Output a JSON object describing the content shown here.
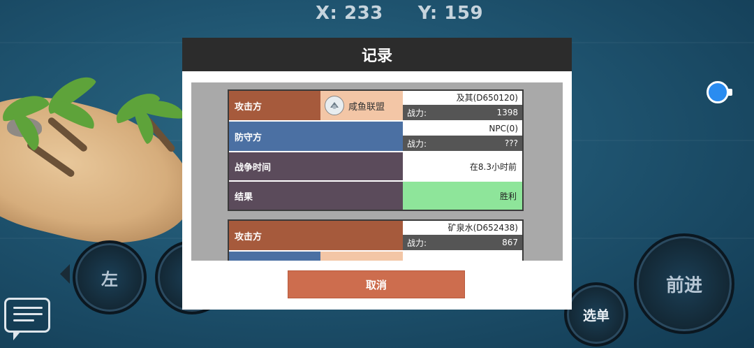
{
  "hud": {
    "x_label": "X: 233",
    "y_label": "Y: 159"
  },
  "dialog": {
    "title": "记录",
    "cancel_label": "取消",
    "records": [
      {
        "attacker_label": "攻击方",
        "attacker_alliance": "咸鱼联盟",
        "attacker_name": "及其(D650120)",
        "attacker_power_label": "战力:",
        "attacker_power": "1398",
        "defender_label": "防守方",
        "defender_name": "NPC(0)",
        "defender_power_label": "战力:",
        "defender_power": "???",
        "time_label": "战争时间",
        "time_value": "在8.3小时前",
        "result_label": "结果",
        "result_value": "胜利"
      },
      {
        "attacker_label": "攻击方",
        "attacker_name": "矿泉水(D652438)",
        "attacker_power_label": "战力:",
        "attacker_power": "867"
      }
    ]
  },
  "controls": {
    "left_label": "左",
    "forward_label": "前进",
    "menu_label": "选单"
  },
  "icons": {
    "chat": "chat-bubble-icon",
    "locate": "compass-indicator-icon",
    "alliance_badge": "alliance-emblem-icon"
  }
}
